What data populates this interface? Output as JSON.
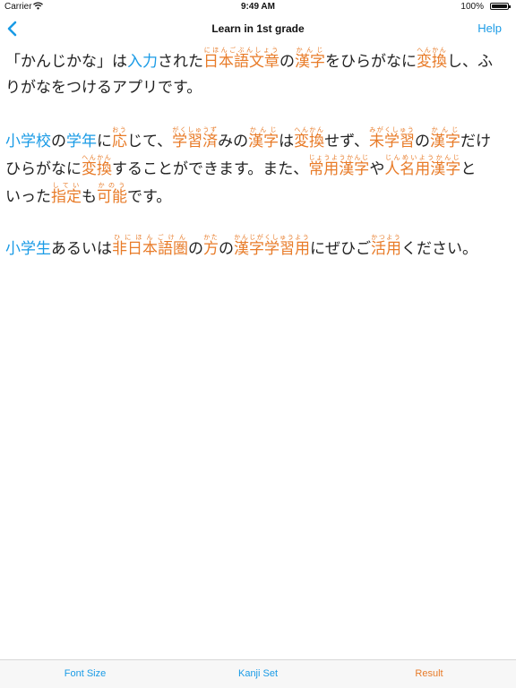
{
  "status_bar": {
    "carrier": "Carrier",
    "time": "9:49 AM",
    "battery_percent": "100%"
  },
  "nav": {
    "title": "Learn in 1st grade",
    "help_label": "Help"
  },
  "colors": {
    "accent_blue": "#1a9be6",
    "highlight_orange": "#e87b28",
    "text": "#222222"
  },
  "paragraphs": [
    {
      "lines": [
        [
          {
            "text": "「かんじかな」は"
          },
          {
            "text": "入力",
            "style": "blue"
          },
          {
            "text": "された"
          },
          {
            "text": "日本語文章",
            "style": "orange",
            "ruby": "にほんごぶんしょう"
          },
          {
            "text": "の"
          },
          {
            "text": "漢字",
            "style": "orange",
            "ruby": "かんじ"
          },
          {
            "text": "をひらがなに"
          },
          {
            "text": "変換",
            "style": "orange",
            "ruby": "へんかん"
          },
          {
            "text": "し、ふ"
          }
        ],
        [
          {
            "text": "りがなをつけるアプリです。"
          }
        ]
      ]
    },
    {
      "lines": [
        [
          {
            "text": "小学校",
            "style": "blue"
          },
          {
            "text": "の"
          },
          {
            "text": "学年",
            "style": "blue"
          },
          {
            "text": "に"
          },
          {
            "text": "応",
            "style": "orange",
            "ruby": "おう"
          },
          {
            "text": "じて、"
          },
          {
            "text": "学習済",
            "style": "orange",
            "ruby": "がくしゅうず"
          },
          {
            "text": "みの"
          },
          {
            "text": "漢字",
            "style": "orange",
            "ruby": "かんじ"
          },
          {
            "text": "は"
          },
          {
            "text": "変換",
            "style": "orange",
            "ruby": "へんかん"
          },
          {
            "text": "せず、"
          },
          {
            "text": "未学習",
            "style": "orange",
            "ruby": "みがくしゅう"
          },
          {
            "text": "の"
          },
          {
            "text": "漢字",
            "style": "orange",
            "ruby": "かんじ"
          },
          {
            "text": "だけ"
          }
        ],
        [
          {
            "text": "ひらがなに"
          },
          {
            "text": "変換",
            "style": "orange",
            "ruby": "へんかん"
          },
          {
            "text": "することができます。また、"
          },
          {
            "text": "常用漢字",
            "style": "orange",
            "ruby": "じょうようかんじ"
          },
          {
            "text": "や"
          },
          {
            "text": "人名用漢字",
            "style": "orange",
            "ruby": "じんめいようかんじ"
          },
          {
            "text": "と"
          }
        ],
        [
          {
            "text": "いった"
          },
          {
            "text": "指定",
            "style": "orange",
            "ruby": "してい"
          },
          {
            "text": "も"
          },
          {
            "text": "可能",
            "style": "orange",
            "ruby": "かのう"
          },
          {
            "text": "です。"
          }
        ]
      ]
    },
    {
      "lines": [
        [
          {
            "text": "小学生",
            "style": "blue"
          },
          {
            "text": "あるいは"
          },
          {
            "text": "非日本語圏",
            "style": "orange",
            "ruby": "ひにほんごけん"
          },
          {
            "text": "の"
          },
          {
            "text": "方",
            "style": "orange",
            "ruby": "かた"
          },
          {
            "text": "の"
          },
          {
            "text": "漢字学習用",
            "style": "orange",
            "ruby": "かんじがくしゅうよう"
          },
          {
            "text": "にぜひご"
          },
          {
            "text": "活用",
            "style": "orange",
            "ruby": "かつよう"
          },
          {
            "text": "ください。"
          }
        ]
      ]
    }
  ],
  "toolbar": {
    "font_size_label": "Font Size",
    "kanji_set_label": "Kanji Set",
    "result_label": "Result"
  },
  "icons": {
    "back": "chevron-left-icon",
    "wifi": "wifi-icon",
    "battery": "battery-icon"
  }
}
